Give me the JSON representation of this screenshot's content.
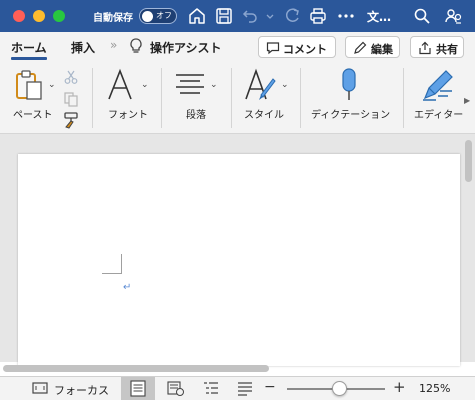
{
  "titlebar": {
    "autosave_label": "自動保存",
    "autosave_state": "オフ",
    "doc_title": "文…",
    "bg_color": "#2b579a"
  },
  "tabs": {
    "home": "ホーム",
    "insert": "挿入",
    "chevrons": "»",
    "assist": "操作アシスト",
    "comment": "コメント",
    "edit": "編集",
    "share": "共有"
  },
  "ribbon": {
    "paste": "ペースト",
    "font": "フォント",
    "paragraph": "段落",
    "styles": "スタイル",
    "dictate": "ディクテーション",
    "editor": "エディター"
  },
  "document": {
    "paragraph_mark": "↵"
  },
  "statusbar": {
    "focus": "フォーカス",
    "zoom_minus": "−",
    "zoom_plus": "+",
    "zoom_percent": "125%",
    "zoom_level": 125
  }
}
